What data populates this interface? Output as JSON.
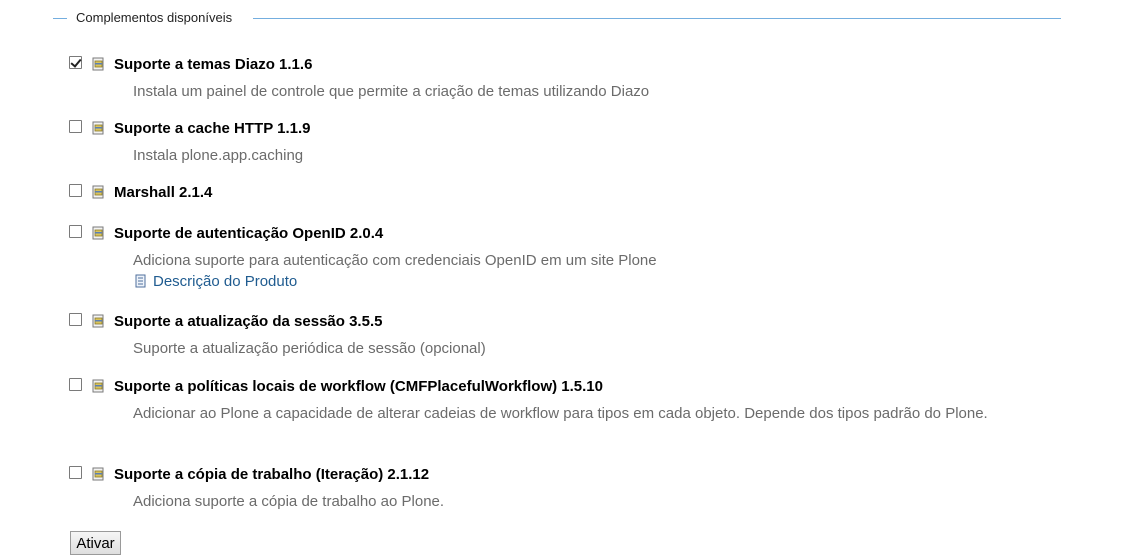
{
  "fieldset": {
    "legend": "Complementos disponíveis"
  },
  "addons": [
    {
      "title": "Suporte a temas Diazo 1.1.6",
      "checked": true,
      "description": "Instala um painel de controle que permite a criação de temas utilizando Diazo"
    },
    {
      "title": "Suporte a cache HTTP 1.1.9",
      "checked": false,
      "description": "Instala plone.app.caching"
    },
    {
      "title": "Marshall 2.1.4",
      "checked": false,
      "description": ""
    },
    {
      "title": "Suporte de autenticação OpenID 2.0.4",
      "checked": false,
      "description": "Adiciona suporte para autenticação com credenciais OpenID em um site Plone",
      "link": "Descrição do Produto"
    },
    {
      "title": "Suporte a atualização da sessão 3.5.5",
      "checked": false,
      "description": "Suporte a atualização periódica de sessão (opcional)"
    },
    {
      "title": "Suporte a políticas locais de workflow (CMFPlacefulWorkflow) 1.5.10",
      "checked": false,
      "description": "Adicionar ao Plone a capacidade de alterar cadeias de workflow para tipos em cada objeto. Depende dos tipos padrão do Plone."
    },
    {
      "title": "Suporte a cópia de trabalho (Iteração) 2.1.12",
      "checked": false,
      "description": "Adiciona suporte a cópia de trabalho ao Plone."
    }
  ],
  "actions": {
    "activate_label": "Ativar"
  },
  "icons": {
    "addon": "package-icon",
    "link": "document-icon"
  },
  "colors": {
    "legend_line": "#74AEDF",
    "link": "#205c90",
    "description": "#6b6b6b"
  }
}
